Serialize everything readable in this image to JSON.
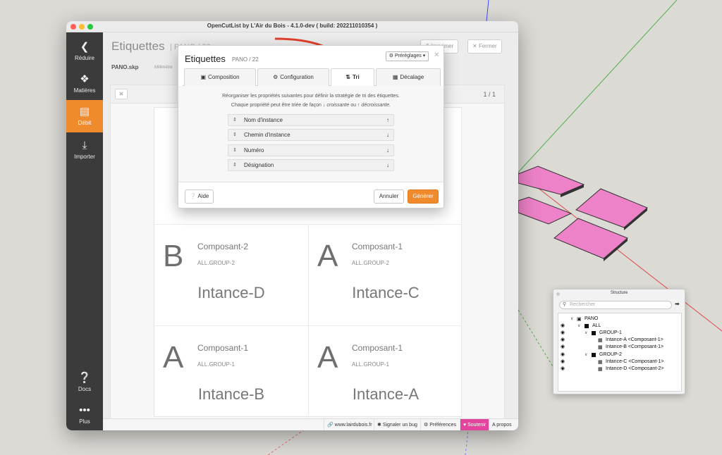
{
  "window": {
    "title": "OpenCutList by L'Air du Bois - 4.1.0-dev ( build: 202211010354 )"
  },
  "sidebar": {
    "items": [
      {
        "label": "Réduire",
        "icon": "chevron-left-icon"
      },
      {
        "label": "Matières",
        "icon": "materials-icon"
      },
      {
        "label": "Débit",
        "icon": "cutlist-icon",
        "active": true
      },
      {
        "label": "Importer",
        "icon": "import-icon"
      },
      {
        "label": "Docs",
        "icon": "help-icon"
      },
      {
        "label": "Plus",
        "icon": "more-icon"
      }
    ]
  },
  "page": {
    "title": "Etiquettes",
    "subtitle": "| PANO / 22",
    "file": "PANO.skp",
    "unit": "Millimètre",
    "print_label": "Imprimer",
    "close_label": "Fermer",
    "page_count": "1 / 1"
  },
  "labels": [
    {
      "letter": "B",
      "component": "Composant-2",
      "group": "ALL.GROUP-2",
      "instance": "Intance-D"
    },
    {
      "letter": "A",
      "component": "Composant-1",
      "group": "ALL.GROUP-2",
      "instance": "Intance-C"
    },
    {
      "letter": "A",
      "component": "Composant-1",
      "group": "ALL.GROUP-1",
      "instance": "Intance-B"
    },
    {
      "letter": "A",
      "component": "Composant-1",
      "group": "ALL.GROUP-1",
      "instance": "Intance-A"
    }
  ],
  "statusbar": {
    "website": "www.lairdubois.fr",
    "report_bug": "Signaler un bug",
    "preferences": "Préférences",
    "support": "Soutenir",
    "about": "A propos"
  },
  "dialog": {
    "title": "Etiquettes",
    "subtitle": "PANO / 22",
    "presets_label": "Préréglages",
    "tabs": [
      {
        "label": "Composition",
        "icon": "layout-icon"
      },
      {
        "label": "Configuration",
        "icon": "gear-icon"
      },
      {
        "label": "Tri",
        "icon": "sort-icon",
        "active": true
      },
      {
        "label": "Décalage",
        "icon": "grid-icon"
      }
    ],
    "hint_line1": "Réorganiser les propriétés suivantes pour définir la stratégie de tri des étiquettes.",
    "hint_line2_a": "Chaque propriété peut être triée de façon",
    "hint_line2_b": "croissante",
    "hint_line2_c": "ou",
    "hint_line2_d": "décroissante.",
    "properties": [
      {
        "name": "Nom d'instance",
        "order": "descending"
      },
      {
        "name": "Chemin d'instance",
        "order": "ascending"
      },
      {
        "name": "Numéro",
        "order": "ascending"
      },
      {
        "name": "Désignation",
        "order": "ascending"
      }
    ],
    "help_label": "Aide",
    "cancel_label": "Annuler",
    "generate_label": "Générer"
  },
  "structure": {
    "title": "Structure",
    "search_placeholder": "Rechercher",
    "nodes": [
      {
        "label": "PANO",
        "level": 0
      },
      {
        "label": "ALL",
        "level": 1
      },
      {
        "label": "GROUP-1",
        "level": 2
      },
      {
        "label": "Intance-A <Composant-1>",
        "level": 3
      },
      {
        "label": "Intance-B <Composant-1>",
        "level": 3
      },
      {
        "label": "GROUP-2",
        "level": 2
      },
      {
        "label": "Intance-C <Composant-1>",
        "level": 3
      },
      {
        "label": "Intance-D <Composant-2>",
        "level": 3
      }
    ]
  },
  "colors": {
    "accent": "#ef8a2d",
    "support": "#e2449e",
    "panel_fill": "#ee82c8",
    "arrow": "#e0402a"
  }
}
